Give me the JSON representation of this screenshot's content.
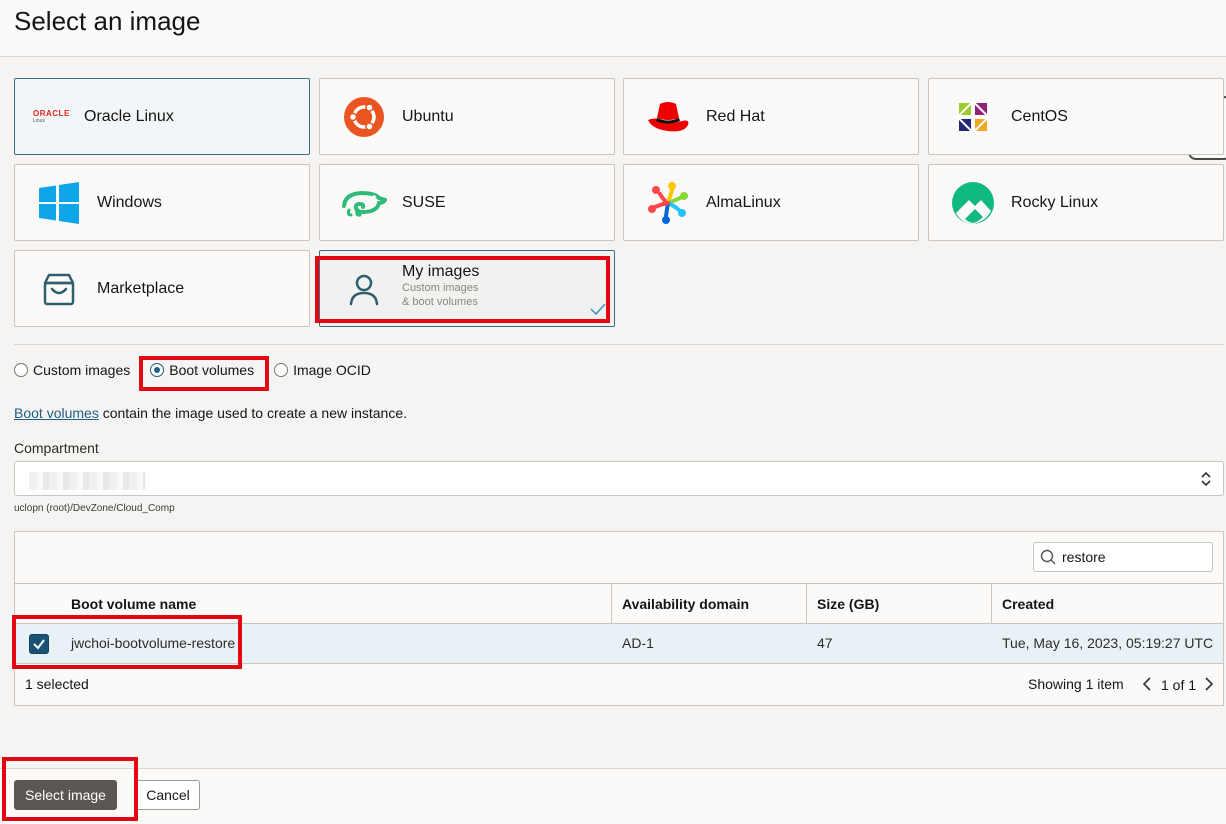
{
  "header": {
    "title": "Select an image"
  },
  "tiles": [
    {
      "label": "Oracle Linux",
      "logo_text": "ORACLE",
      "logo_sub": "Linux"
    },
    {
      "label": "Ubuntu"
    },
    {
      "label": "Red Hat"
    },
    {
      "label": "CentOS"
    },
    {
      "label": "Windows"
    },
    {
      "label": "SUSE"
    },
    {
      "label": "AlmaLinux"
    },
    {
      "label": "Rocky Linux"
    },
    {
      "label": "Marketplace"
    },
    {
      "label": "My images",
      "sub1": "Custom images",
      "sub2": "& boot volumes"
    }
  ],
  "source_options": [
    {
      "label": "Custom images",
      "selected": false
    },
    {
      "label": "Boot volumes",
      "selected": true
    },
    {
      "label": "Image OCID",
      "selected": false
    }
  ],
  "description": {
    "link": "Boot volumes",
    "text": " contain the image used to create a new instance."
  },
  "compartment": {
    "label": "Compartment",
    "path": "uclopn (root)/DevZone/Cloud_Comp"
  },
  "table": {
    "search_value": "restore",
    "columns": [
      "Boot volume name",
      "Availability domain",
      "Size (GB)",
      "Created"
    ],
    "rows": [
      {
        "name": "jwchoi-bootvolume-restore",
        "ad": "AD-1",
        "size": "47",
        "created": "Tue, May 16, 2023, 05:19:27 UTC",
        "checked": true
      }
    ],
    "selected_text": "1 selected",
    "showing_text": "Showing 1 item",
    "page_text": "1 of 1"
  },
  "actions": {
    "primary": "Select image",
    "cancel": "Cancel"
  },
  "colors": {
    "accent": "#1f5e86",
    "highlight": "#e30613",
    "selected_row": "#e8f1f5"
  }
}
